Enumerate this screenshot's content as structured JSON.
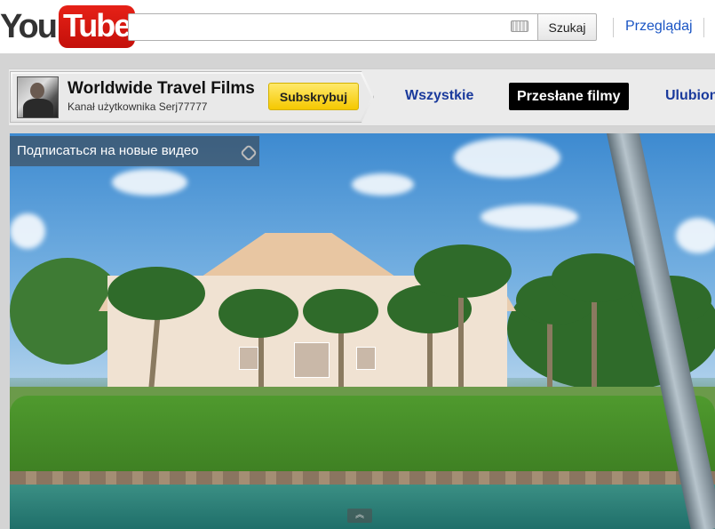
{
  "header": {
    "logo_you": "You",
    "logo_tube": "Tube",
    "search_placeholder": "",
    "search_button": "Szukaj",
    "browse_link": "Przeglądaj"
  },
  "channel": {
    "title": "Worldwide Travel Films",
    "subtitle": "Kanał użytkownika Serj77777",
    "subscribe_button": "Subskrybuj",
    "tabs": [
      {
        "label": "Wszystkie",
        "active": false
      },
      {
        "label": "Przesłane filmy",
        "active": true
      },
      {
        "label": "Ulubione",
        "active": false
      }
    ]
  },
  "video": {
    "overlay_text": "Подписаться на новые видео",
    "expand_icon": "chevron-up-icon"
  },
  "colors": {
    "brand_red": "#e62117",
    "link_blue": "#1a55c4",
    "subscribe_yellow": "#f5c800"
  }
}
